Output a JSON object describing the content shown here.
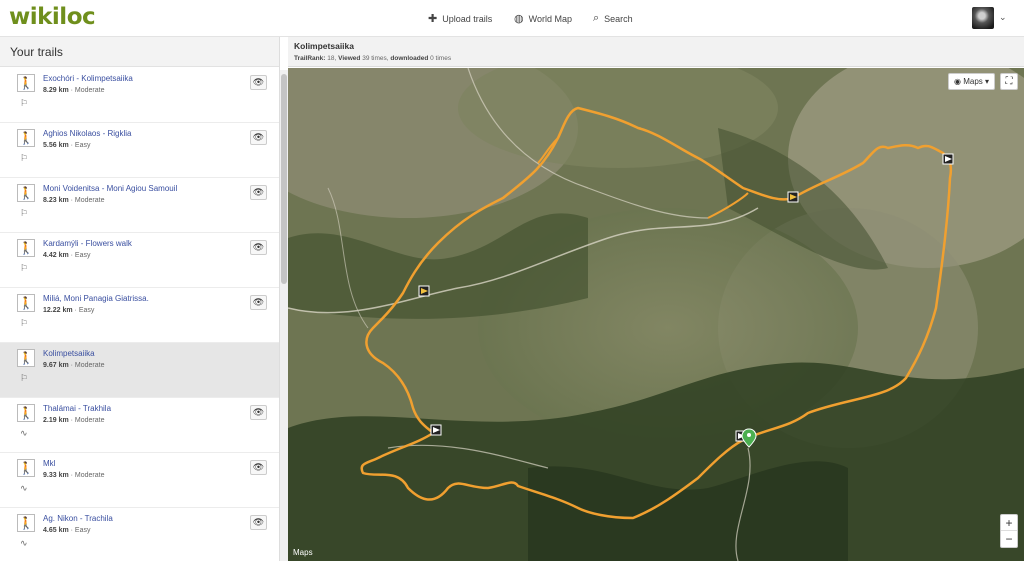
{
  "header": {
    "logo": "wikiloc",
    "nav": [
      {
        "label": "Upload trails",
        "icon": "plus-icon"
      },
      {
        "label": "World Map",
        "icon": "globe-icon"
      },
      {
        "label": "Search",
        "icon": "search-icon"
      }
    ],
    "avatar_caret": "⌄"
  },
  "sidebar": {
    "title": "Your trails",
    "trails": [
      {
        "name": "Exochóri - Kolimpetsaiika",
        "distance": "8.29 km",
        "difficulty": "Moderate",
        "selected": false
      },
      {
        "name": "Aghios Nikolaos - Rigklia",
        "distance": "5.56 km",
        "difficulty": "Easy",
        "selected": false
      },
      {
        "name": "Moni Voidenitsa - Moni Agiou Samouil",
        "distance": "8.23 km",
        "difficulty": "Moderate",
        "selected": false
      },
      {
        "name": "Kardamýli - Flowers walk",
        "distance": "4.42 km",
        "difficulty": "Easy",
        "selected": false
      },
      {
        "name": "Miliá, Moni Panagia Giatrissa.",
        "distance": "12.22 km",
        "difficulty": "Easy",
        "selected": false
      },
      {
        "name": "Kolimpetsaiika",
        "distance": "9.67 km",
        "difficulty": "Moderate",
        "selected": true
      },
      {
        "name": "Thalámai - Trakhila",
        "distance": "2.19 km",
        "difficulty": "Moderate",
        "selected": false
      },
      {
        "name": "Mkl",
        "distance": "9.33 km",
        "difficulty": "Moderate",
        "selected": false
      },
      {
        "name": "Ag. Nikon - Trachila",
        "distance": "4.65 km",
        "difficulty": "Easy",
        "selected": false
      }
    ]
  },
  "detail": {
    "title": "Kolimpetsaiika",
    "trailrank_label": "TrailRank:",
    "trailrank_value": "18,",
    "viewed_label": "Viewed",
    "viewed_value": "39 times,",
    "downloaded_label": "downloaded",
    "downloaded_value": "0 times"
  },
  "map": {
    "type_label": "Maps",
    "attribution": "Maps",
    "zoom_in": "+",
    "zoom_out": "−",
    "route_color": "#f0a030",
    "start_marker_color": "#4caf50"
  }
}
